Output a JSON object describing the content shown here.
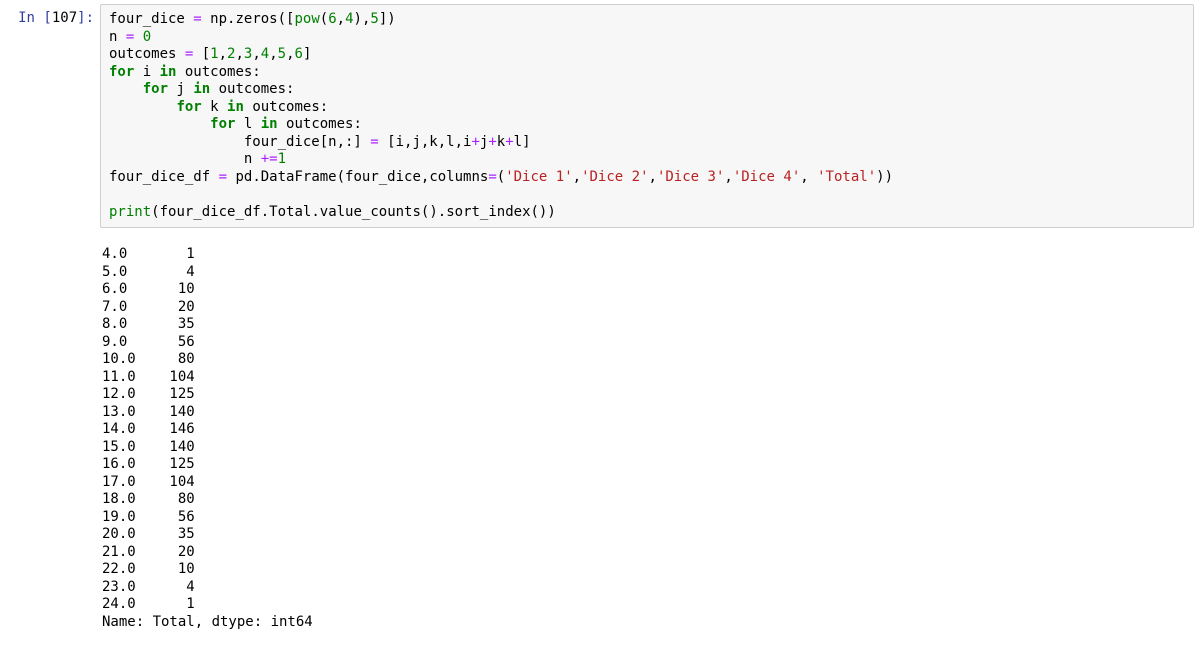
{
  "cell": {
    "prompt_prefix": "In [",
    "prompt_num": "107",
    "prompt_suffix": "]:",
    "code_tokens": [
      {
        "t": "four_dice ",
        "c": "tok-id"
      },
      {
        "t": "=",
        "c": "tok-purple"
      },
      {
        "t": " np",
        "c": "tok-id"
      },
      {
        "t": ".",
        "c": "tok-punc"
      },
      {
        "t": "zeros([",
        "c": "tok-id"
      },
      {
        "t": "pow",
        "c": "tok-bi"
      },
      {
        "t": "(",
        "c": "tok-punc"
      },
      {
        "t": "6",
        "c": "tok-num"
      },
      {
        "t": ",",
        "c": "tok-punc"
      },
      {
        "t": "4",
        "c": "tok-num"
      },
      {
        "t": "),",
        "c": "tok-punc"
      },
      {
        "t": "5",
        "c": "tok-num"
      },
      {
        "t": "])",
        "c": "tok-punc"
      },
      {
        "t": "\n",
        "c": ""
      },
      {
        "t": "n ",
        "c": "tok-id"
      },
      {
        "t": "=",
        "c": "tok-purple"
      },
      {
        "t": " ",
        "c": ""
      },
      {
        "t": "0",
        "c": "tok-num"
      },
      {
        "t": "\n",
        "c": ""
      },
      {
        "t": "outcomes ",
        "c": "tok-id"
      },
      {
        "t": "=",
        "c": "tok-purple"
      },
      {
        "t": " [",
        "c": "tok-punc"
      },
      {
        "t": "1",
        "c": "tok-num"
      },
      {
        "t": ",",
        "c": "tok-punc"
      },
      {
        "t": "2",
        "c": "tok-num"
      },
      {
        "t": ",",
        "c": "tok-punc"
      },
      {
        "t": "3",
        "c": "tok-num"
      },
      {
        "t": ",",
        "c": "tok-punc"
      },
      {
        "t": "4",
        "c": "tok-num"
      },
      {
        "t": ",",
        "c": "tok-punc"
      },
      {
        "t": "5",
        "c": "tok-num"
      },
      {
        "t": ",",
        "c": "tok-punc"
      },
      {
        "t": "6",
        "c": "tok-num"
      },
      {
        "t": "]",
        "c": "tok-punc"
      },
      {
        "t": "\n",
        "c": ""
      },
      {
        "t": "for",
        "c": "tok-kw"
      },
      {
        "t": " i ",
        "c": "tok-id"
      },
      {
        "t": "in",
        "c": "tok-kw"
      },
      {
        "t": " outcomes:",
        "c": "tok-id"
      },
      {
        "t": "\n",
        "c": ""
      },
      {
        "t": "    ",
        "c": ""
      },
      {
        "t": "for",
        "c": "tok-kw"
      },
      {
        "t": " j ",
        "c": "tok-id"
      },
      {
        "t": "in",
        "c": "tok-kw"
      },
      {
        "t": " outcomes:",
        "c": "tok-id"
      },
      {
        "t": "\n",
        "c": ""
      },
      {
        "t": "        ",
        "c": ""
      },
      {
        "t": "for",
        "c": "tok-kw"
      },
      {
        "t": " k ",
        "c": "tok-id"
      },
      {
        "t": "in",
        "c": "tok-kw"
      },
      {
        "t": " outcomes:",
        "c": "tok-id"
      },
      {
        "t": "\n",
        "c": ""
      },
      {
        "t": "            ",
        "c": ""
      },
      {
        "t": "for",
        "c": "tok-kw"
      },
      {
        "t": " l ",
        "c": "tok-id"
      },
      {
        "t": "in",
        "c": "tok-kw"
      },
      {
        "t": " outcomes:",
        "c": "tok-id"
      },
      {
        "t": "\n",
        "c": ""
      },
      {
        "t": "                four_dice[n,:] ",
        "c": "tok-id"
      },
      {
        "t": "=",
        "c": "tok-purple"
      },
      {
        "t": " [i,j,k,l,i",
        "c": "tok-id"
      },
      {
        "t": "+",
        "c": "tok-purple"
      },
      {
        "t": "j",
        "c": "tok-id"
      },
      {
        "t": "+",
        "c": "tok-purple"
      },
      {
        "t": "k",
        "c": "tok-id"
      },
      {
        "t": "+",
        "c": "tok-purple"
      },
      {
        "t": "l]",
        "c": "tok-id"
      },
      {
        "t": "\n",
        "c": ""
      },
      {
        "t": "                n ",
        "c": "tok-id"
      },
      {
        "t": "+=",
        "c": "tok-purple"
      },
      {
        "t": "1",
        "c": "tok-num"
      },
      {
        "t": "\n",
        "c": ""
      },
      {
        "t": "four_dice_df ",
        "c": "tok-id"
      },
      {
        "t": "=",
        "c": "tok-purple"
      },
      {
        "t": " pd",
        "c": "tok-id"
      },
      {
        "t": ".",
        "c": "tok-punc"
      },
      {
        "t": "DataFrame(four_dice,columns",
        "c": "tok-id"
      },
      {
        "t": "=",
        "c": "tok-purple"
      },
      {
        "t": "(",
        "c": "tok-punc"
      },
      {
        "t": "'Dice 1'",
        "c": "tok-str"
      },
      {
        "t": ",",
        "c": "tok-punc"
      },
      {
        "t": "'Dice 2'",
        "c": "tok-str"
      },
      {
        "t": ",",
        "c": "tok-punc"
      },
      {
        "t": "'Dice 3'",
        "c": "tok-str"
      },
      {
        "t": ",",
        "c": "tok-punc"
      },
      {
        "t": "'Dice 4'",
        "c": "tok-str"
      },
      {
        "t": ", ",
        "c": "tok-punc"
      },
      {
        "t": "'Total'",
        "c": "tok-str"
      },
      {
        "t": "))",
        "c": "tok-punc"
      },
      {
        "t": "\n",
        "c": ""
      },
      {
        "t": "\n",
        "c": ""
      },
      {
        "t": "print",
        "c": "tok-bi"
      },
      {
        "t": "(four_dice_df",
        "c": "tok-id"
      },
      {
        "t": ".",
        "c": "tok-punc"
      },
      {
        "t": "Total",
        "c": "tok-id"
      },
      {
        "t": ".",
        "c": "tok-punc"
      },
      {
        "t": "value_counts()",
        "c": "tok-id"
      },
      {
        "t": ".",
        "c": "tok-punc"
      },
      {
        "t": "sort_index())",
        "c": "tok-id"
      }
    ],
    "output_lines": [
      "4.0       1",
      "5.0       4",
      "6.0      10",
      "7.0      20",
      "8.0      35",
      "9.0      56",
      "10.0     80",
      "11.0    104",
      "12.0    125",
      "13.0    140",
      "14.0    146",
      "15.0    140",
      "16.0    125",
      "17.0    104",
      "18.0     80",
      "19.0     56",
      "20.0     35",
      "21.0     20",
      "22.0     10",
      "23.0      4",
      "24.0      1",
      "Name: Total, dtype: int64"
    ]
  }
}
